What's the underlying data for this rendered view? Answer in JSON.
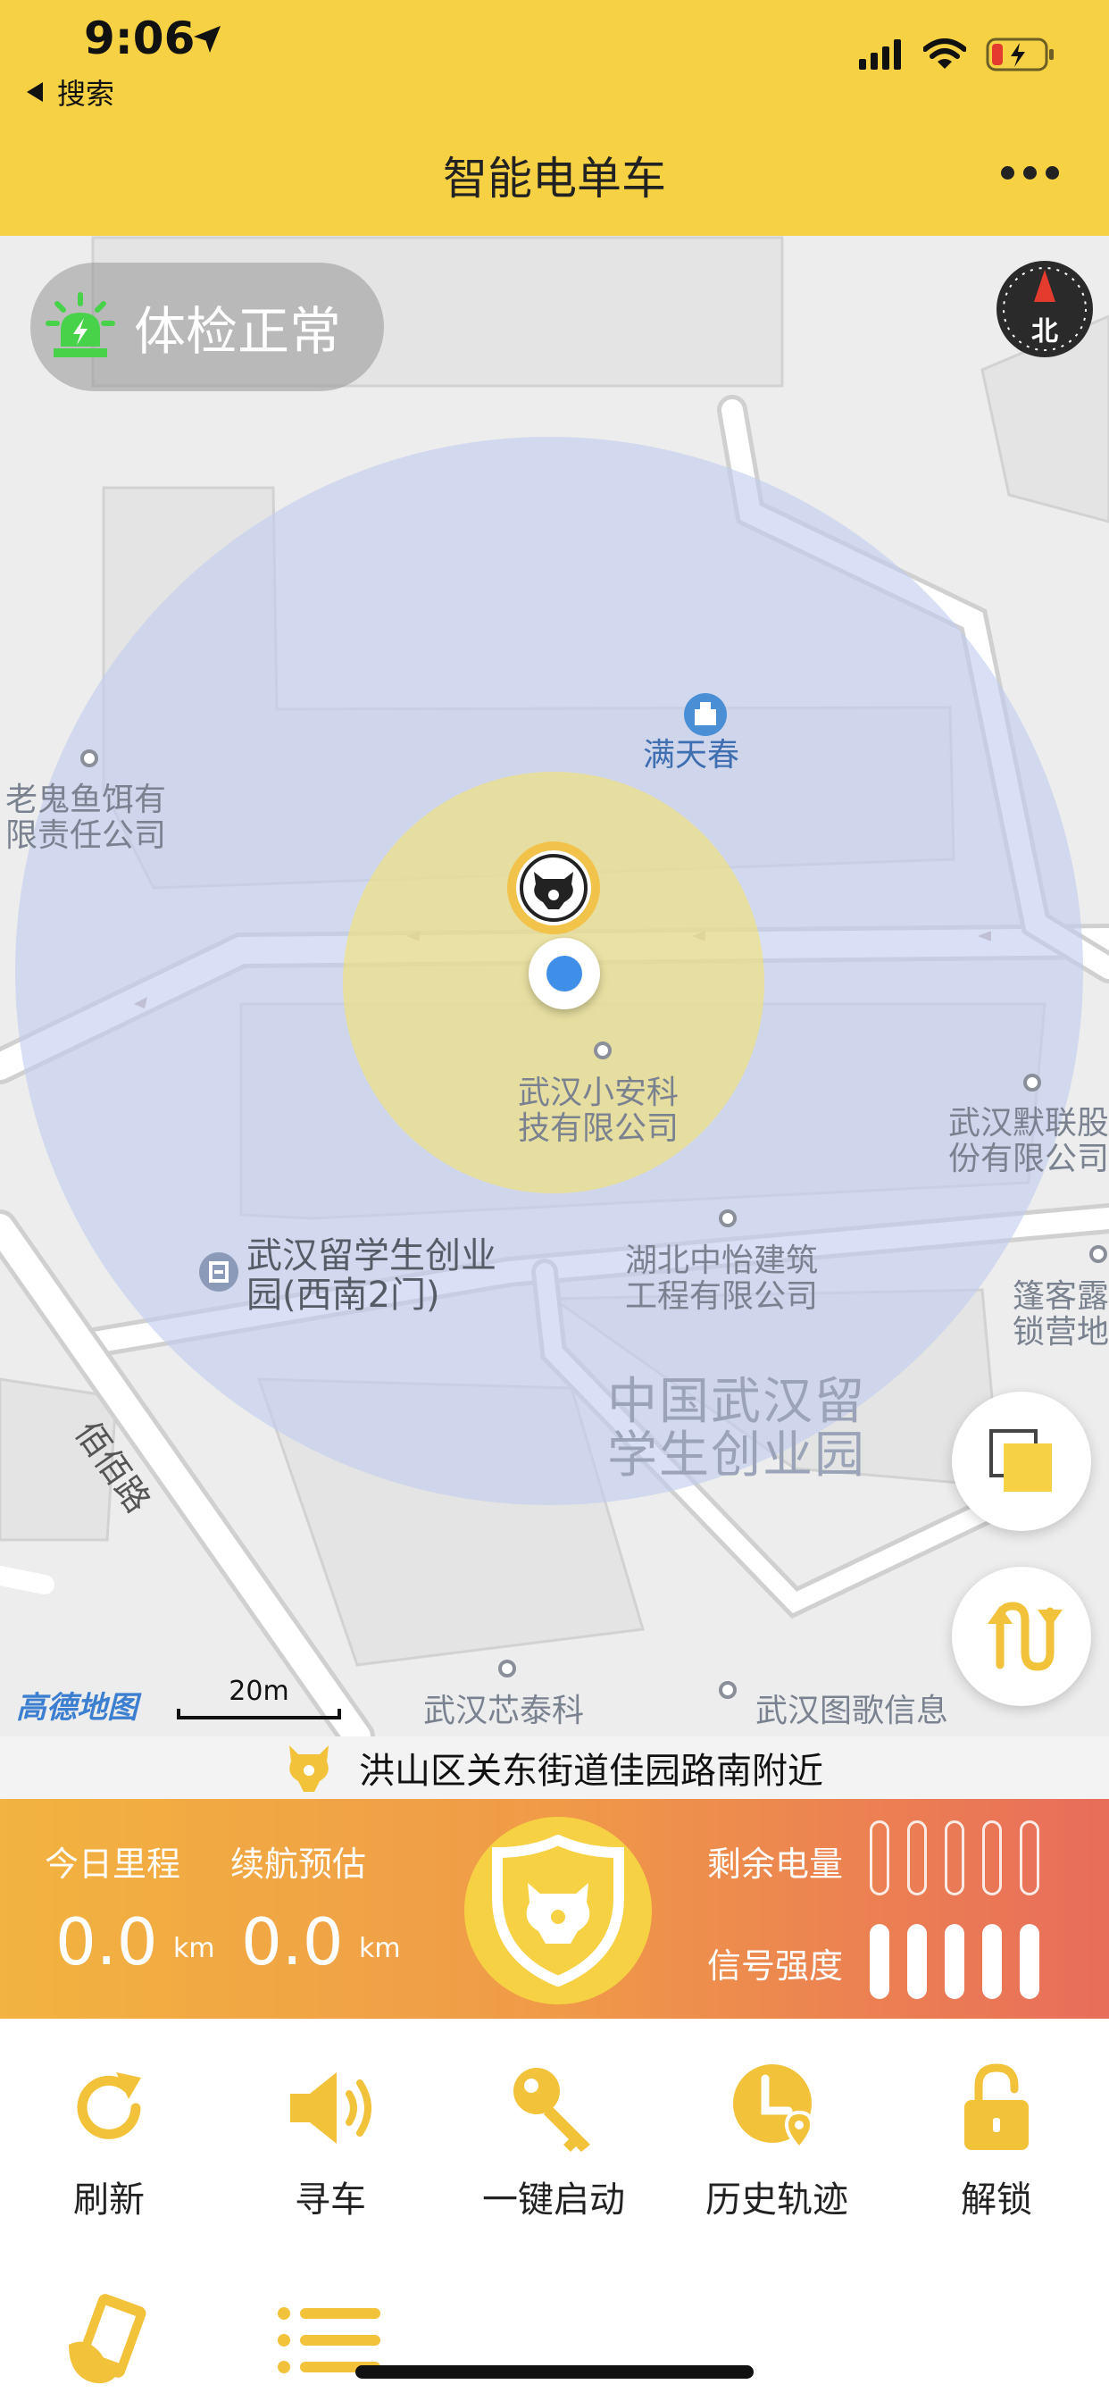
{
  "status_bar": {
    "time": "9:06",
    "back_label": "搜索"
  },
  "nav": {
    "title": "智能电单车"
  },
  "map": {
    "health_status": "体检正常",
    "compass_label": "北",
    "labels": {
      "poi_mantianchun": "满天春",
      "poi_laoguiyu_1": "老鬼鱼饵有",
      "poi_laoguiyu_2": "限责任公司",
      "poi_xiaoan_1": "武汉小安科",
      "poi_xiaoan_2": "技有限公司",
      "poi_morlian_1": "武汉默联股",
      "poi_morlian_2": "份有限公司",
      "poi_liuxue_1": "武汉留学生创业",
      "poi_liuxue_2": "园(西南2门)",
      "poi_zhongyi_1": "湖北中怡建筑",
      "poi_zhongyi_2": "工程有限公司",
      "poi_pengke_1": "篷客露",
      "poi_pengke_2": "锁营地",
      "area_chuangye_1": "中国武汉留",
      "area_chuangye_2": "学生创业园",
      "road_name": "佰佰路",
      "poi_xintai": "武汉芯泰科",
      "poi_tuge": "武汉图歌信息"
    },
    "logo": "高德地图",
    "scale": "20m"
  },
  "address": "洪山区关东街道佳园路南附近",
  "stats": {
    "mileage_label": "今日里程",
    "mileage_value": "0.0",
    "mileage_unit": "km",
    "range_label": "续航预估",
    "range_value": "0.0",
    "range_unit": "km",
    "battery_label": "剩余电量",
    "battery_level": 0,
    "signal_label": "信号强度",
    "signal_level": 5
  },
  "actions": [
    {
      "label": "刷新",
      "icon": "refresh-icon"
    },
    {
      "label": "寻车",
      "icon": "speaker-icon"
    },
    {
      "label": "一键启动",
      "icon": "key-icon"
    },
    {
      "label": "历史轨迹",
      "icon": "clock-location-icon"
    },
    {
      "label": "解锁",
      "icon": "unlock-icon"
    }
  ],
  "actions_row2": [
    {
      "icon": "phone-hand-icon"
    },
    {
      "icon": "list-icon"
    }
  ],
  "colors": {
    "brand_yellow": "#f6d144",
    "accent_orange": "#f09a48",
    "accent_red": "#e86d5a"
  }
}
